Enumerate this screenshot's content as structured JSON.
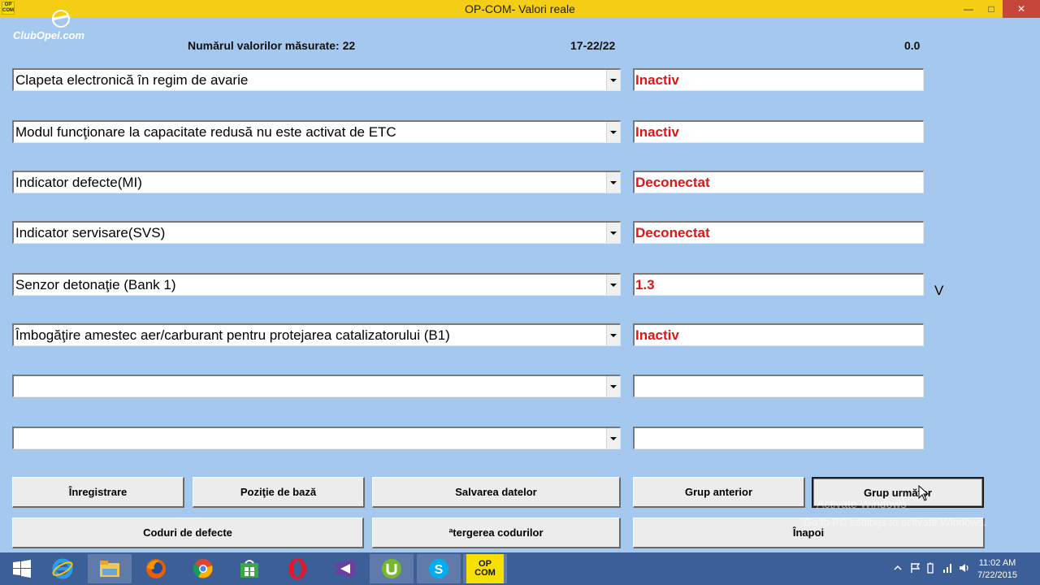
{
  "window": {
    "title": "OP-COM- Valori reale",
    "app_icon_text": "OP COM"
  },
  "logo": {
    "text": "ClubOpel.com"
  },
  "header": {
    "count_label": "Numărul valorilor măsurate: 22",
    "range": "17-22/22",
    "time_value": "0.0"
  },
  "rows": [
    {
      "param": "Clapeta electronică în regim de avarie",
      "value": "Inactiv",
      "unit": ""
    },
    {
      "param": "Modul funcţionare la capacitate redusă nu este activat de ETC",
      "value": "Inactiv",
      "unit": ""
    },
    {
      "param": "Indicator defecte(MI)",
      "value": "Deconectat",
      "unit": ""
    },
    {
      "param": "Indicator servisare(SVS)",
      "value": "Deconectat",
      "unit": ""
    },
    {
      "param": "Senzor detonaţie (Bank 1)",
      "value": "1.3",
      "unit": "V"
    },
    {
      "param": "Îmbogăţire amestec aer/carburant pentru protejarea catalizatorului (B1)",
      "value": "Inactiv",
      "unit": ""
    },
    {
      "param": "",
      "value": "",
      "unit": ""
    },
    {
      "param": "",
      "value": "",
      "unit": ""
    }
  ],
  "buttons": {
    "record": "Înregistrare",
    "base_position": "Poziţie de bază",
    "save_data": "Salvarea datelor",
    "prev_group": "Grup anterior",
    "next_group": "Grup următor",
    "fault_codes": "Coduri de defecte",
    "clear_codes": "ªtergerea codurilor",
    "back": "Înapoi"
  },
  "watermark": {
    "line1": "Activate Windows",
    "line2": "Go to PC settings to activate Windows."
  },
  "taskbar": {
    "apps": [
      "start-icon",
      "internet-explorer-icon",
      "file-explorer-icon",
      "firefox-icon",
      "chrome-icon",
      "store-icon",
      "opera-icon",
      "visual-studio-icon",
      "utorrent-icon",
      "skype-icon",
      "opcom-icon"
    ],
    "opcom_label": "OP COM",
    "time": "11:02 AM",
    "date": "7/22/2015"
  },
  "colors": {
    "background": "#a4c8ee",
    "titlebar": "#f3ce14",
    "value_text": "#e21414",
    "taskbar": "#3d5f97"
  }
}
